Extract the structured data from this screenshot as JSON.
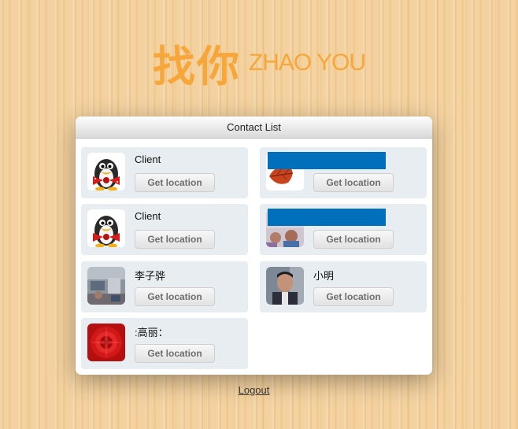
{
  "logo": {
    "chinese": "找你",
    "english": "ZHAO YOU"
  },
  "panel": {
    "title": "Contact List"
  },
  "contacts": [
    {
      "name": "Client",
      "button": "Get location",
      "avatar": "penguin-avatar-icon"
    },
    {
      "name": "",
      "button": "Get location",
      "avatar": "leaf-avatar-icon",
      "redacted": true
    },
    {
      "name": "Client",
      "button": "Get location",
      "avatar": "penguin-avatar-icon"
    },
    {
      "name": "",
      "button": "Get location",
      "avatar": "people-photo-avatar",
      "redacted": true
    },
    {
      "name": "李子骅",
      "button": "Get location",
      "avatar": "room-photo-avatar"
    },
    {
      "name": "小明",
      "button": "Get location",
      "avatar": "man-photo-avatar"
    },
    {
      "name": ":高丽：",
      "button": "Get location",
      "avatar": "red-flower-avatar"
    }
  ],
  "logout": "Logout",
  "colors": {
    "accent": "#f7a63a",
    "card": "#e8edf1",
    "redact": "#0070bd"
  }
}
